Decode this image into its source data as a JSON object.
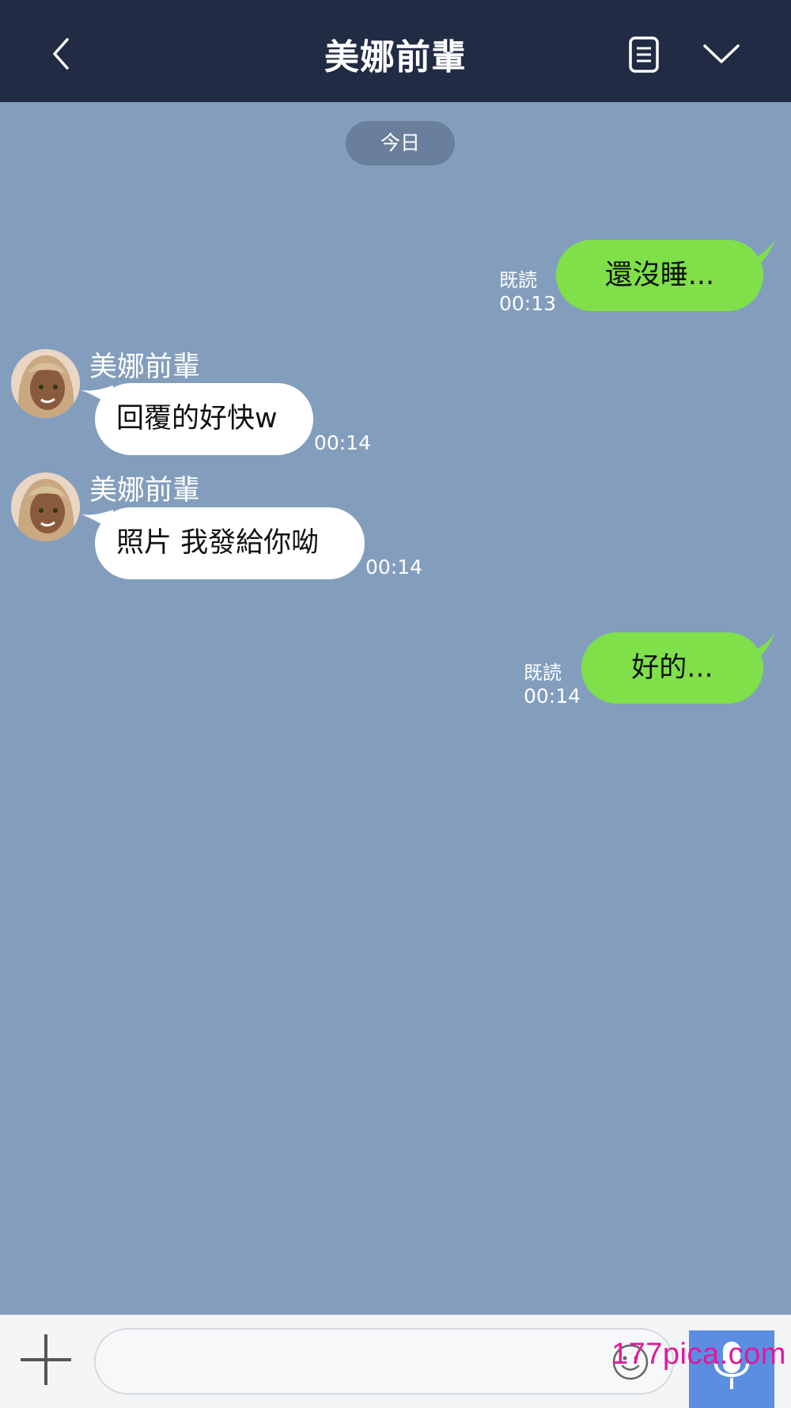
{
  "header": {
    "title": "美娜前輩",
    "back_icon": "chevron-left-icon",
    "notes_icon": "notes-icon",
    "menu_icon": "chevron-down-icon"
  },
  "chat": {
    "date_label": "今日",
    "messages": [
      {
        "direction": "outgoing",
        "text": "還沒睡...",
        "read_label": "既読",
        "time": "00:13"
      },
      {
        "direction": "incoming",
        "sender": "美娜前輩",
        "text": "回覆的好快w",
        "time": "00:14"
      },
      {
        "direction": "incoming",
        "sender": "美娜前輩",
        "text": "照片 我發給你呦",
        "time": "00:14"
      },
      {
        "direction": "outgoing",
        "text": "好的...",
        "read_label": "既読",
        "time": "00:14"
      }
    ]
  },
  "composer": {
    "input_value": "",
    "plus_icon": "plus-icon",
    "emoji_icon": "emoji-icon",
    "mic_icon": "microphone-icon"
  },
  "watermark": "177pica.com",
  "colors": {
    "header_bg": "#222b44",
    "chat_bg": "#839ebd",
    "outgoing_bubble": "#7fe04a",
    "incoming_bubble": "#ffffff",
    "mic_button": "#5b8de3",
    "watermark": "#e0189b"
  }
}
